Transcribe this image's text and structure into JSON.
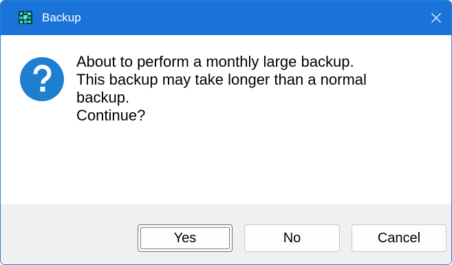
{
  "window": {
    "title": "Backup",
    "app_icon": "backup-app-icon",
    "close_icon": "close-icon"
  },
  "dialog": {
    "icon": "question-icon",
    "message_lines": [
      "About to perform a monthly large backup.",
      "This backup may take longer than a normal",
      "backup.",
      "Continue?"
    ]
  },
  "buttons": {
    "yes_label": "Yes",
    "no_label": "No",
    "cancel_label": "Cancel",
    "focused": "Yes"
  },
  "colors": {
    "titlebar": "#1a73d9",
    "question_icon": "#1e7fd0",
    "footer": "#f0f0f0"
  }
}
